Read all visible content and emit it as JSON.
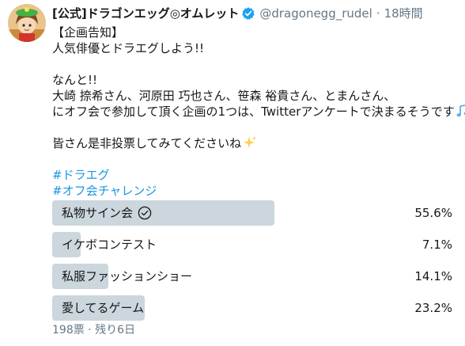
{
  "header": {
    "display_name": "[公式]ドラゴンエッグ◎オムレット",
    "handle": "@dragonegg_rudel",
    "dot": "·",
    "time": "18時間"
  },
  "tweet": {
    "line1": "【企画告知】",
    "line2": "人気俳優とドラエグしよう!!",
    "line3": "なんと!!",
    "line4": "大崎 捺希さん、河原田 巧也さん、笹森 裕貴さん、とまんさん、",
    "line5": "にオフ会で参加して頂く企画の1つは、Twitterアンケートで決まるそうです",
    "line6": "皆さん是非投票してみてくださいね",
    "hashtag1": "#ドラエグ",
    "hashtag2": "#オフ会チャレンジ"
  },
  "icons": {
    "verified": "verified-badge-icon",
    "music": "musical-notes-icon",
    "sparkle": "sparkles-icon",
    "check": "checkmark-circle-icon"
  },
  "colors": {
    "link": "#1b95e0",
    "verified": "#1da1f2",
    "bar": "#ccd6dd",
    "secondary_text": "#657786"
  },
  "poll": {
    "options": [
      {
        "label": "私物サイン会",
        "percent_text": "55.6%",
        "percent": 55.6,
        "leading": true
      },
      {
        "label": "イケボコンテスト",
        "percent_text": "7.1%",
        "percent": 7.1,
        "leading": false
      },
      {
        "label": "私服ファッションショー",
        "percent_text": "14.1%",
        "percent": 14.1,
        "leading": false
      },
      {
        "label": "愛してるゲーム",
        "percent_text": "23.2%",
        "percent": 23.2,
        "leading": false
      }
    ],
    "meta": "198票 · 残り6日"
  }
}
